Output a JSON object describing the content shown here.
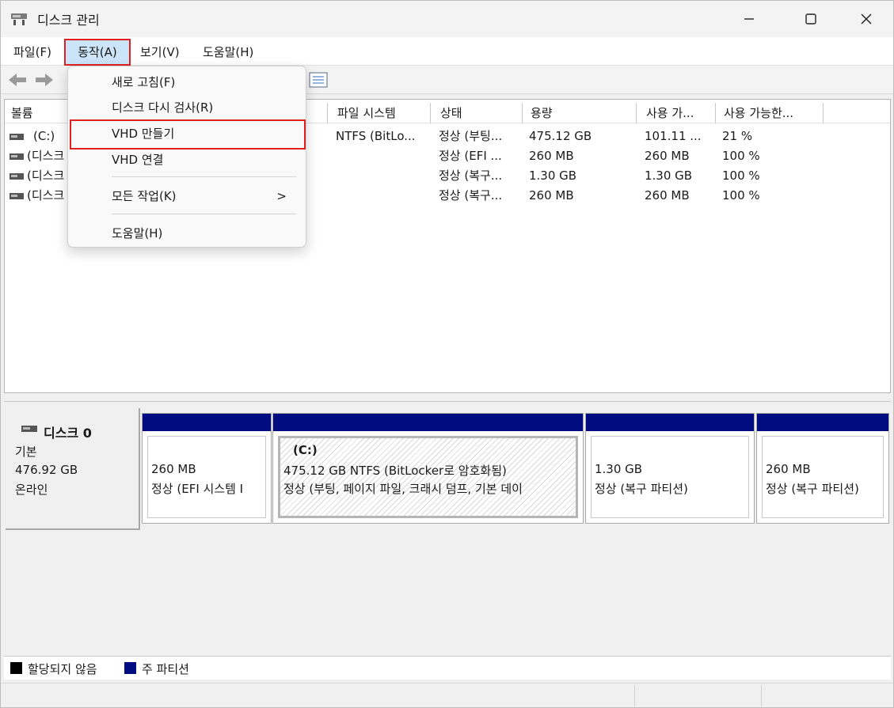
{
  "window": {
    "title": "디스크 관리"
  },
  "menubar": {
    "file": "파일(F)",
    "action": "동작(A)",
    "view": "보기(V)",
    "help": "도움말(H)"
  },
  "dropdown": {
    "refresh": "새로 고침(F)",
    "rescan": "디스크 다시 검사(R)",
    "create_vhd": "VHD 만들기",
    "attach_vhd": "VHD 연결",
    "all_tasks": "모든 작업(K)",
    "all_tasks_arrow": ">",
    "help": "도움말(H)"
  },
  "list": {
    "columns": [
      "볼륨",
      "파일 시스템",
      "상태",
      "용량",
      "사용 가...",
      "사용 가능한..."
    ],
    "rows": [
      {
        "volume": "(C:)",
        "fs": "NTFS (BitLo...",
        "status": "정상 (부팅...",
        "capacity": "475.12 GB",
        "free": "101.11 ...",
        "pct": "21 %"
      },
      {
        "volume": "(디스크",
        "fs": "",
        "status": "정상 (EFI ...",
        "capacity": "260 MB",
        "free": "260 MB",
        "pct": "100 %"
      },
      {
        "volume": "(디스크",
        "fs": "",
        "status": "정상 (복구...",
        "capacity": "1.30 GB",
        "free": "1.30 GB",
        "pct": "100 %"
      },
      {
        "volume": "(디스크",
        "fs": "",
        "status": "정상 (복구...",
        "capacity": "260 MB",
        "free": "260 MB",
        "pct": "100 %"
      }
    ]
  },
  "disk": {
    "name": "디스크 0",
    "type": "기본",
    "size": "476.92 GB",
    "state": "온라인",
    "partitions": [
      {
        "label": "",
        "line1": "260 MB",
        "line2": "정상 (EFI 시스템 I"
      },
      {
        "label": "(C:)",
        "line1": "475.12 GB NTFS (BitLocker로 암호화됨)",
        "line2": "정상 (부팅, 페이지 파일, 크래시 덤프, 기본 데이"
      },
      {
        "label": "",
        "line1": "1.30 GB",
        "line2": "정상 (복구 파티션)"
      },
      {
        "label": "",
        "line1": "260 MB",
        "line2": "정상 (복구 파티션)"
      }
    ]
  },
  "legend": {
    "unallocated": "할당되지 않음",
    "primary": "주 파티션"
  },
  "colors": {
    "primary_partition": "#000c80",
    "unallocated": "#000000",
    "highlight": "#e02020",
    "menu_active": "#cce4f7"
  }
}
